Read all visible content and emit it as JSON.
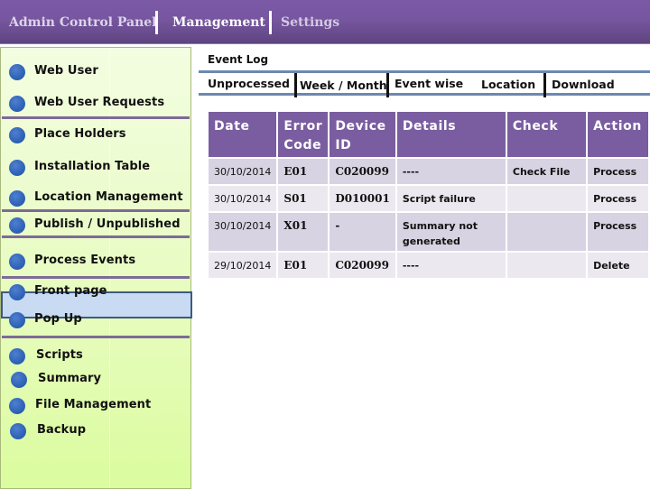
{
  "header": {
    "title": "Admin Control Panel",
    "nav": [
      "Management",
      "Settings"
    ],
    "colors": {
      "header": "#7b59a6",
      "sidebar": "#e9fcc4",
      "table_header": "#7a5da0",
      "accent_blue": "#2f63b7"
    }
  },
  "sidebar": {
    "items": [
      {
        "label": "Web User",
        "icon": "bullet-dot"
      },
      {
        "label": "Web User Requests",
        "icon": "bullet-dot"
      },
      {
        "label": "Place Holders",
        "icon": "bullet-dot"
      },
      {
        "label": "Installation Table",
        "icon": "bullet-dot"
      },
      {
        "label": "Location Management",
        "icon": "bullet-dot"
      },
      {
        "label": "Publish / Unpublished",
        "icon": "bullet-dot"
      },
      {
        "label": "Process Events",
        "icon": "bullet-dot",
        "active": true
      },
      {
        "label": "Front page",
        "icon": "bullet-dot"
      },
      {
        "label": "Pop Up",
        "icon": "bullet-dot"
      },
      {
        "label": "Scripts",
        "icon": "bullet-dot"
      },
      {
        "label": "Summary",
        "icon": "bullet-dot"
      },
      {
        "label": "File Management",
        "icon": "bullet-dot"
      },
      {
        "label": "Backup",
        "icon": "bullet-dot"
      }
    ]
  },
  "main": {
    "section_title": "Event Log",
    "tabs": [
      "Unprocessed",
      "Week / Month",
      "Event wise",
      "Location",
      "Download"
    ],
    "table": {
      "columns": [
        "Date",
        "Error Code",
        "Device ID",
        "Details",
        "Check",
        "Action"
      ],
      "column_lines": [
        [
          "Date"
        ],
        [
          "Error",
          "Code"
        ],
        [
          "Device",
          "ID"
        ],
        [
          "Details"
        ],
        [
          "Check"
        ],
        [
          "Action"
        ]
      ],
      "rows": [
        {
          "date": "30/10/2014",
          "code": "E01",
          "device": "C020099",
          "details": "----",
          "check": "Check File",
          "action": "Process"
        },
        {
          "date": "30/10/2014",
          "code": "S01",
          "device": "D010001",
          "details": "Script failure",
          "check": "",
          "action": "Process"
        },
        {
          "date": "30/10/2014",
          "code": "X01",
          "device": "-",
          "details": "Summary not generated",
          "check": "",
          "action": "Process"
        },
        {
          "date": "29/10/2014",
          "code": "E01",
          "device": "C020099",
          "details": "----",
          "check": "",
          "action": "Delete"
        }
      ]
    }
  }
}
